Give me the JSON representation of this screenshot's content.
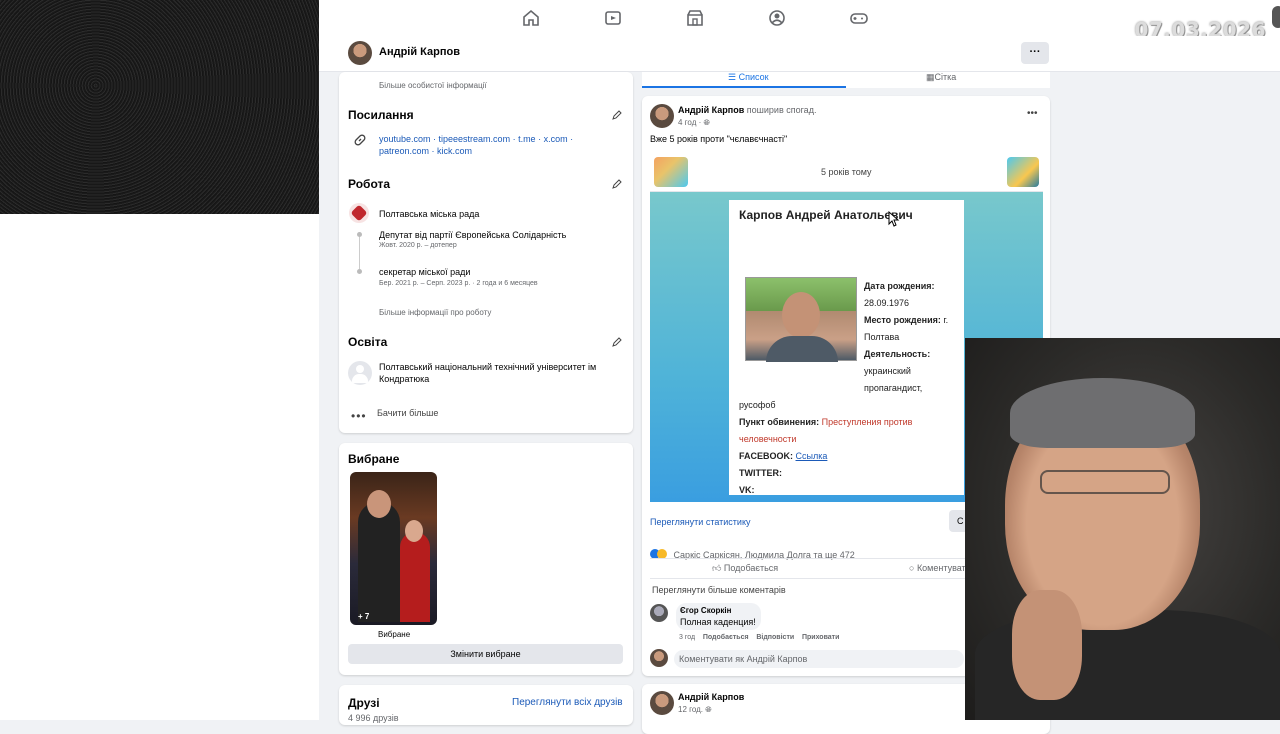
{
  "date_stamp": "07.03.2026",
  "profile": {
    "name": "Андрій Карпов"
  },
  "intro": {
    "more_personal": "Більше особистої інформації"
  },
  "links": {
    "heading": "Посилання",
    "line1": [
      "youtube.com",
      "tipeeestream.com",
      "t.me",
      "x.com"
    ],
    "line2": [
      "patreon.com",
      "kick.com"
    ],
    "separator": " · "
  },
  "work": {
    "heading": "Робота",
    "org": "Полтавська міська рада",
    "positions": [
      {
        "title": "Депутат від партії Європейська Солідарність",
        "dates": "Жовт. 2020 р. – дотепер"
      },
      {
        "title": "секретар міської ради",
        "dates": "Бер. 2021 р. – Серп. 2023 р. · 2 года и 6 месяцев"
      }
    ],
    "more": "Більше інформації про роботу"
  },
  "education": {
    "heading": "Освіта",
    "school": "Полтавський національний технічний університет ім Кондратюка",
    "see_more": "Бачити більше"
  },
  "favorites": {
    "heading": "Вибране",
    "count_badge": "+ 7",
    "caption": "Вибране",
    "change_button": "Змінити вибране"
  },
  "friends": {
    "heading": "Друзі",
    "see_all": "Переглянути всіх друзів",
    "count": "4 996 друзів"
  },
  "view_tabs": {
    "list": "Список",
    "grid": "Сітка"
  },
  "post1": {
    "author": "Андрій Карпов",
    "action": "поширив спогад.",
    "time": "4 год",
    "text": "Вже 5 років проти \"чєлавєчнасті\"",
    "memory_label": "5 років тому",
    "doc": {
      "name": "Карпов Андрей Анатольевич",
      "dob_label": "Дата рождения:",
      "dob": "28.09.1976",
      "pob_label": "Место рождения:",
      "pob_1": "г.",
      "pob_2": "Полтава",
      "activity_label": "Деятельность:",
      "activity_1": "украинский",
      "activity_2": "пропагандист,",
      "activity_3": "русофоб",
      "charge_label": "Пункт обвинения:",
      "charge_1": "Преступления против",
      "charge_2": "человечности",
      "facebook_label": "FACEBOOK:",
      "facebook_link": "Ссылка",
      "twitter_label": "TWITTER:",
      "vk_label": "VK:"
    },
    "stats_link": "Переглянути статистику",
    "stats_btn_partial": "С",
    "reactions_text": "Саркіс Саркісян, Людмила Долга та ще 472",
    "like": "Подобається",
    "comment_partial": "Коментувати",
    "more_comments": "Переглянути більше коментарів",
    "comment": {
      "author": "Єгор Скоркін",
      "text": "Полная каденция!",
      "time": "3 год",
      "like": "Подобається",
      "reply": "Відповісти",
      "hide": "Приховати"
    },
    "comment_placeholder": "Коментувати як Андрій Карпов"
  },
  "post2": {
    "author": "Андрій Карпов",
    "time": "12 год."
  },
  "colors": {
    "accent": "#1b74e4",
    "link": "#1b5ab8",
    "charge_red": "#c0392b"
  }
}
